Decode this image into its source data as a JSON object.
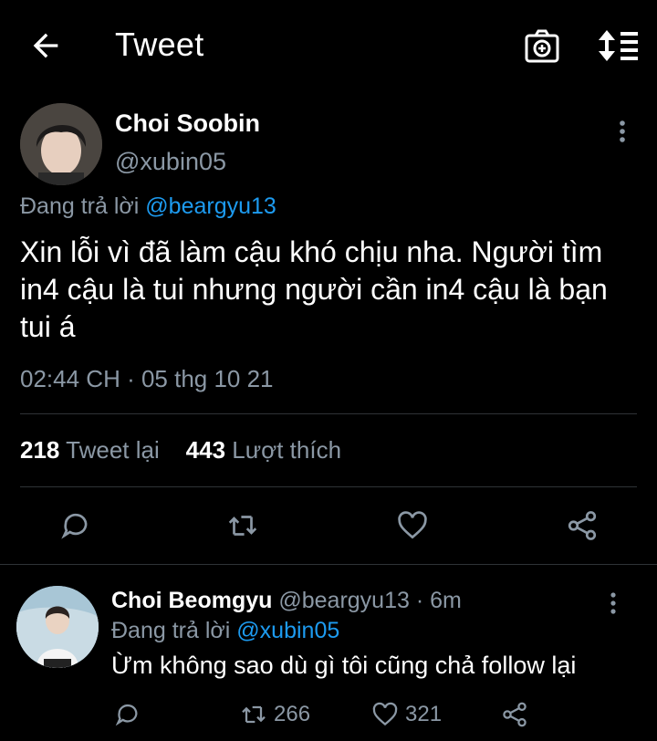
{
  "header": {
    "title": "Tweet",
    "back_icon": "arrow-left-icon",
    "camera_icon": "camera-icon",
    "sort_icon": "sort-icon"
  },
  "tweet": {
    "author_name": "Choi Soobin",
    "author_handle": "@xubin05",
    "replying_label": "Đang trả lời",
    "replying_to": "@beargyu13",
    "text": "Xin lỗi vì đã làm cậu khó chịu nha. Người tìm in4 cậu là tui nhưng người cần in4 cậu là bạn tui á",
    "timestamp": "02:44 CH · 05 thg 10 21",
    "retweet_count": "218",
    "retweet_label": "Tweet lại",
    "like_count": "443",
    "like_label": "Lượt thích"
  },
  "reply": {
    "author_name": "Choi Beomgyu",
    "author_handle": "@beargyu13",
    "separator": "·",
    "time": "6m",
    "replying_label": "Đang trả lời",
    "replying_to": "@xubin05",
    "text": "Ừm không sao dù gì tôi cũng chả follow lại",
    "retweet_count": "266",
    "like_count": "321"
  },
  "colors": {
    "background": "#000000",
    "secondary_text": "#8b98a5",
    "link": "#1d9bf0",
    "divider": "#2f3336"
  }
}
